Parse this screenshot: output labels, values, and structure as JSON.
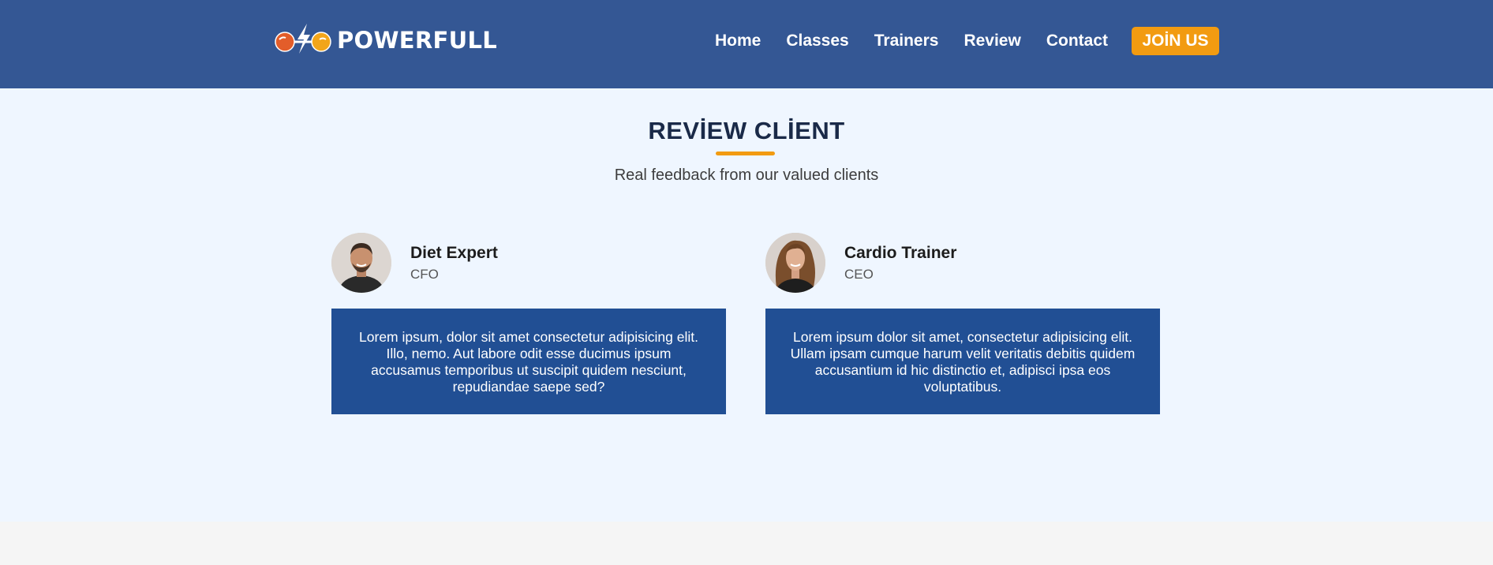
{
  "brand": {
    "name": "POWERFULL",
    "logo_icon": "dumbbell-lightning-icon"
  },
  "nav": {
    "items": [
      "Home",
      "Classes",
      "Trainers",
      "Review",
      "Contact"
    ],
    "cta": "JOİN US"
  },
  "review": {
    "title": "REVİEW CLİENT",
    "subtitle": "Real feedback from our valued clients",
    "cards": [
      {
        "name": "Diet Expert",
        "role": "CFO",
        "text": "Lorem ipsum, dolor sit amet consectetur adipisicing elit. Illo, nemo. Aut labore odit esse ducimus ipsum accusamus temporibus ut suscipit quidem nesciunt, repudiandae saepe sed?"
      },
      {
        "name": "Cardio Trainer",
        "role": "CEO",
        "text": "Lorem ipsum dolor sit amet, consectetur adipisicing elit. Ullam ipsam cumque harum velit veritatis debitis quidem accusantium id hic distinctio et, adipisci ipsa eos voluptatibus."
      }
    ]
  },
  "colors": {
    "header_bg": "#345794",
    "accent": "#f29b11",
    "card_bg": "#214f94",
    "section_bg": "#eff6ff"
  }
}
